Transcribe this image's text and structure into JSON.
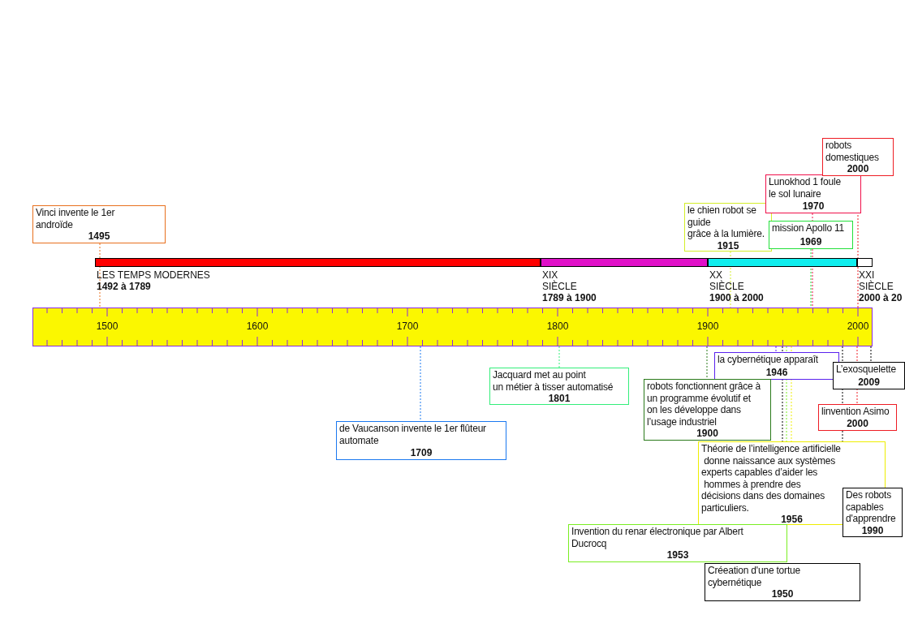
{
  "eras": [
    {
      "name": "LES TEMPS MODERNES",
      "dates": "1492 à 1789",
      "color": "#ff0000"
    },
    {
      "name": "XIX\nSIÈCLE",
      "dates": "1789 à 1900",
      "color": "#e010c8"
    },
    {
      "name": "XX\nSIÈCLE",
      "dates": "1900 à 2000",
      "color": "#10eeee"
    },
    {
      "name": "XXI\nSIÈCLE",
      "dates": "2000 à 20",
      "color": "#ffffff"
    }
  ],
  "ruler": {
    "labels": [
      "1500",
      "1600",
      "1700",
      "1800",
      "1900",
      "2000"
    ]
  },
  "events": [
    {
      "text": "Vinci invente le 1er\nandroïde",
      "year": "1495",
      "color": "#e8701e"
    },
    {
      "text": "le chien robot se\nguide\ngrâce à la lumière.",
      "year": "1915",
      "color": "#d4ee2a"
    },
    {
      "text": "Lunokhod 1 foule\nle sol lunaire",
      "year": "1970",
      "color": "#f0104a"
    },
    {
      "text": "robots\ndomestiques",
      "year": "2000",
      "color": "#ee1c24"
    },
    {
      "text": "mission Apollo 11",
      "year": "1969",
      "color": "#22e03a"
    },
    {
      "text": "Jacquard met au point\nun métier à tisser automatisé",
      "year": "1801",
      "color": "#33ee7a"
    },
    {
      "text": "de Vaucanson invente le 1er flûteur\nautomate",
      "year": "1709",
      "color": "#1a78f0"
    },
    {
      "text": "la cybernétique apparaît",
      "year": "1946",
      "color": "#5a22ee"
    },
    {
      "text": "L’exosquelette",
      "year": "2009",
      "color": "#000000"
    },
    {
      "text": "robots fonctionnent grâce à\nun programme évolutif et\non les développe dans\nl’usage industriel",
      "year": "1900",
      "color": "#2a7a1a"
    },
    {
      "text": "linvention Asimo",
      "year": "2000",
      "color": "#ee1c24"
    },
    {
      "text": "Théorie de l’intelligence artificielle\n donne naissance aux systèmes\nexperts capables d’aider les\n hommes à prendre des\ndécisions dans des domaines\nparticuliers.",
      "year": "1956",
      "color": "#eeee00"
    },
    {
      "text": "Des robots\ncapables\nd'apprendre",
      "year": "1990",
      "color": "#000000"
    },
    {
      "text": "Invention du renar électronique par Albert\nDucrocq",
      "year": "1953",
      "color": "#7aee22"
    },
    {
      "text": "Créeation d'une tortue\ncybernétique",
      "year": "1950",
      "color": "#000000"
    }
  ]
}
